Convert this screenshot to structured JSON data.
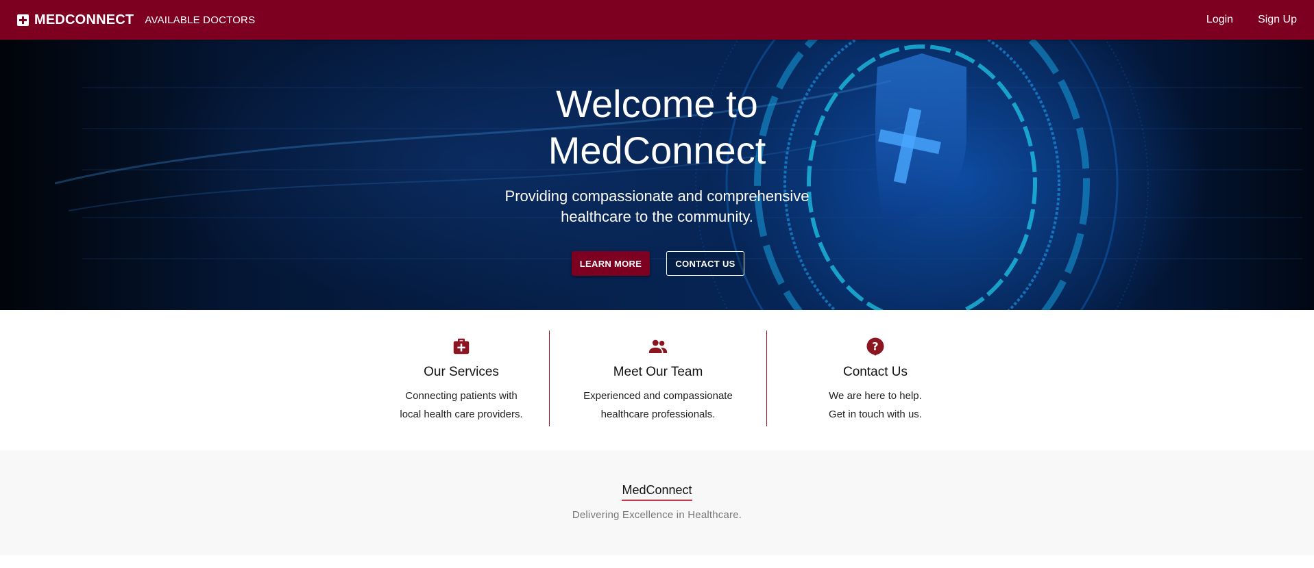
{
  "navbar": {
    "brand": "MEDCONNECT",
    "brand_icon": "medical-cross-icon",
    "link": "AVAILABLE DOCTORS",
    "login": "Login",
    "signup": "Sign Up"
  },
  "hero": {
    "title_line1": "Welcome to",
    "title_line2": "MedConnect",
    "subtitle_line1": "Providing compassionate and comprehensive",
    "subtitle_line2": "healthcare to the community.",
    "primary_button": "LEARN MORE",
    "secondary_button": "CONTACT US"
  },
  "features": [
    {
      "icon": "medical-kit-icon",
      "title": "Our Services",
      "desc_line1": "Connecting patients with",
      "desc_line2": "local health care providers."
    },
    {
      "icon": "people-icon",
      "title": "Meet Our Team",
      "desc_line1": "Experienced and compassionate",
      "desc_line2": "healthcare professionals."
    },
    {
      "icon": "question-icon",
      "title": "Contact Us",
      "desc_line1": "We are here to help.",
      "desc_line2": "Get in touch with us."
    }
  ],
  "footer": {
    "title": "MedConnect",
    "tagline": "Delivering Excellence in Healthcare."
  },
  "colors": {
    "brand": "#7e0020",
    "footer_bg": "#f8f8f8"
  }
}
